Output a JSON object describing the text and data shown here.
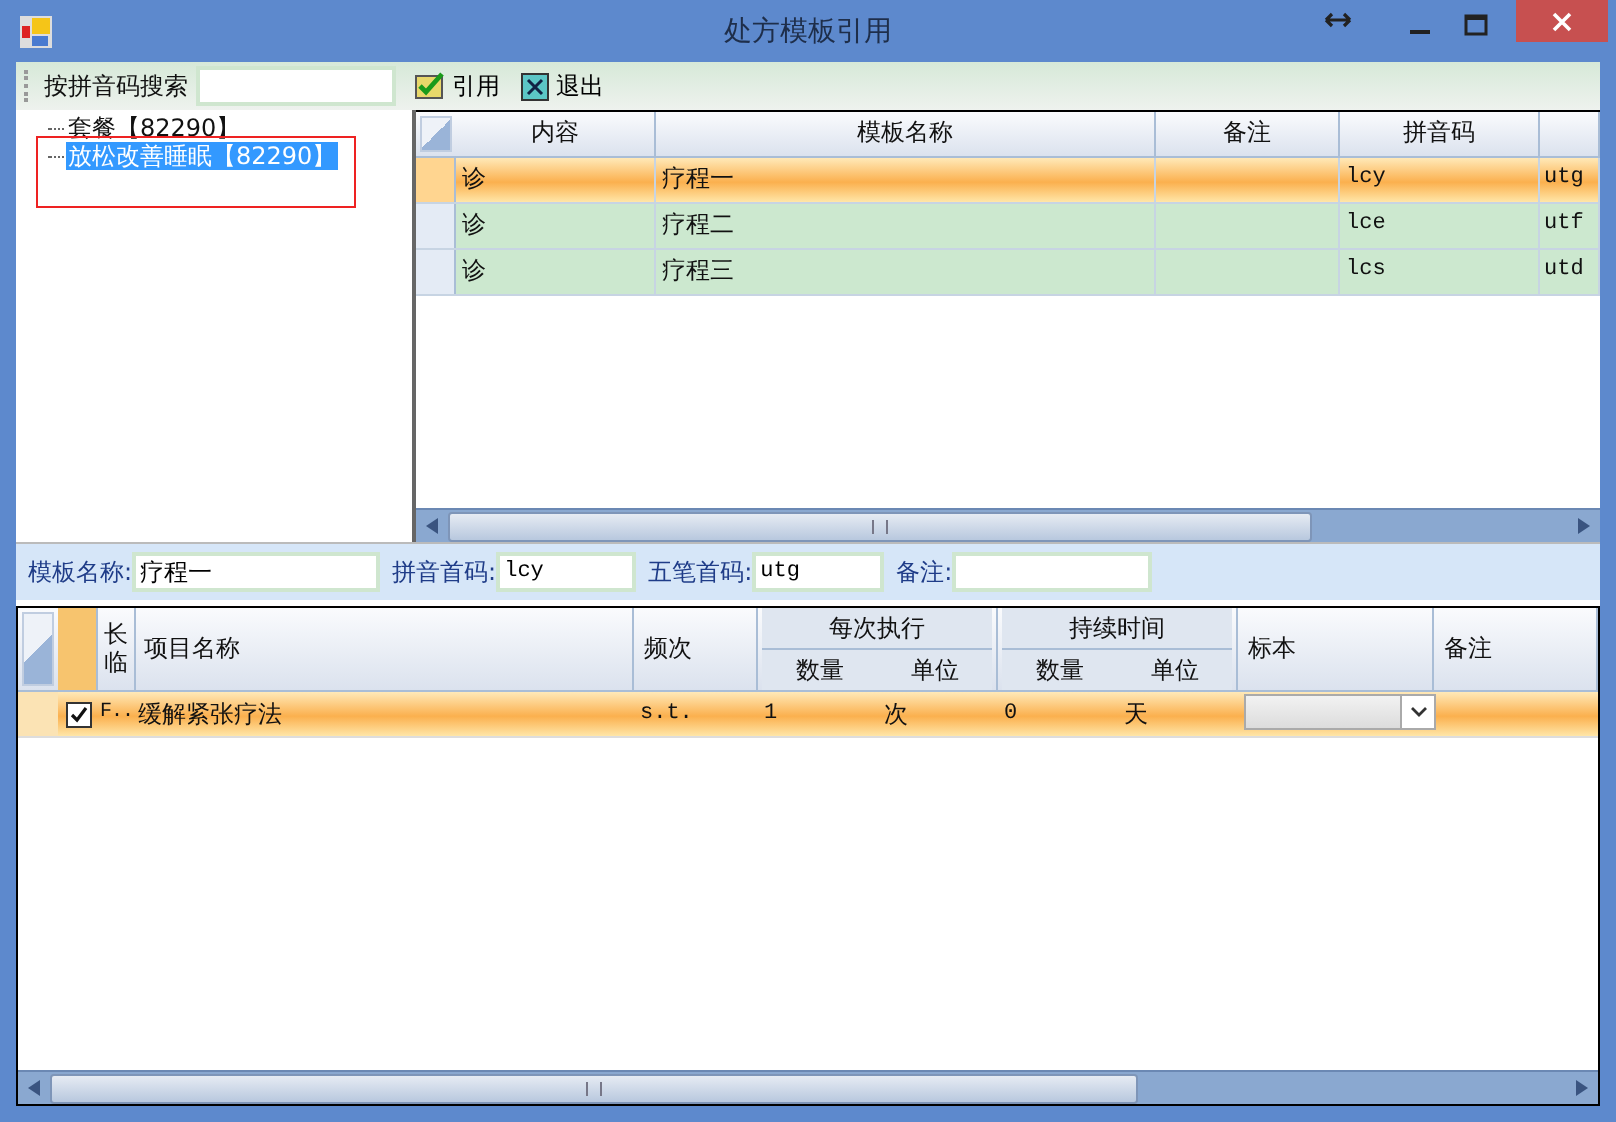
{
  "window": {
    "title": "处方模板引用",
    "controls": [
      {
        "kind": "resize"
      },
      {
        "kind": "minimize"
      },
      {
        "kind": "maximize"
      },
      {
        "kind": "close"
      }
    ]
  },
  "toolbar": {
    "search_label": "按拼音码搜索",
    "buttons": [
      {
        "label": "引用",
        "kind": "confirm"
      },
      {
        "label": "退出",
        "kind": "exit"
      }
    ]
  },
  "tree": {
    "items": [
      {
        "label": "套餐【82290】",
        "selected": false
      },
      {
        "label": "放松改善睡眠【82290】",
        "selected": true
      }
    ]
  },
  "templates": {
    "columns": [
      "内容",
      "模板名称",
      "备注",
      "拼音码"
    ],
    "rows": [
      {
        "content": "诊",
        "name": "疗程一",
        "pinyin": "lcy",
        "column_5": "utg",
        "selected": true
      },
      {
        "content": "诊",
        "name": "疗程二",
        "pinyin": "lce",
        "column_5": "utf",
        "selected": false
      },
      {
        "content": "诊",
        "name": "疗程三",
        "pinyin": "lcs",
        "column_5": "utd",
        "selected": false
      }
    ]
  },
  "form": {
    "fields": [
      {
        "label": "模板名称:",
        "value": "疗程一"
      },
      {
        "label": "拼音首码:",
        "value": "lcy"
      },
      {
        "label": "五笔首码:",
        "value": "utg"
      },
      {
        "label": "备注:"
      }
    ]
  },
  "items": {
    "columns": {
      "long_temp": "长临",
      "name": "项目名称",
      "frequency": "频次",
      "per_dose": "每次执行",
      "duration": "持续时间",
      "qty": "数量",
      "unit": "单位",
      "qty_2": "数量",
      "unit_2": "单位",
      "specimen": "标本",
      "note": "备注"
    },
    "rows": [
      {
        "checked": true,
        "code": "F..",
        "name": "缓解紧张疗法",
        "frequency": "s.t.",
        "dose_qty": "1",
        "dose_unit": "次",
        "duration_qty": "0",
        "duration_unit": "天",
        "selected": true
      }
    ]
  }
}
